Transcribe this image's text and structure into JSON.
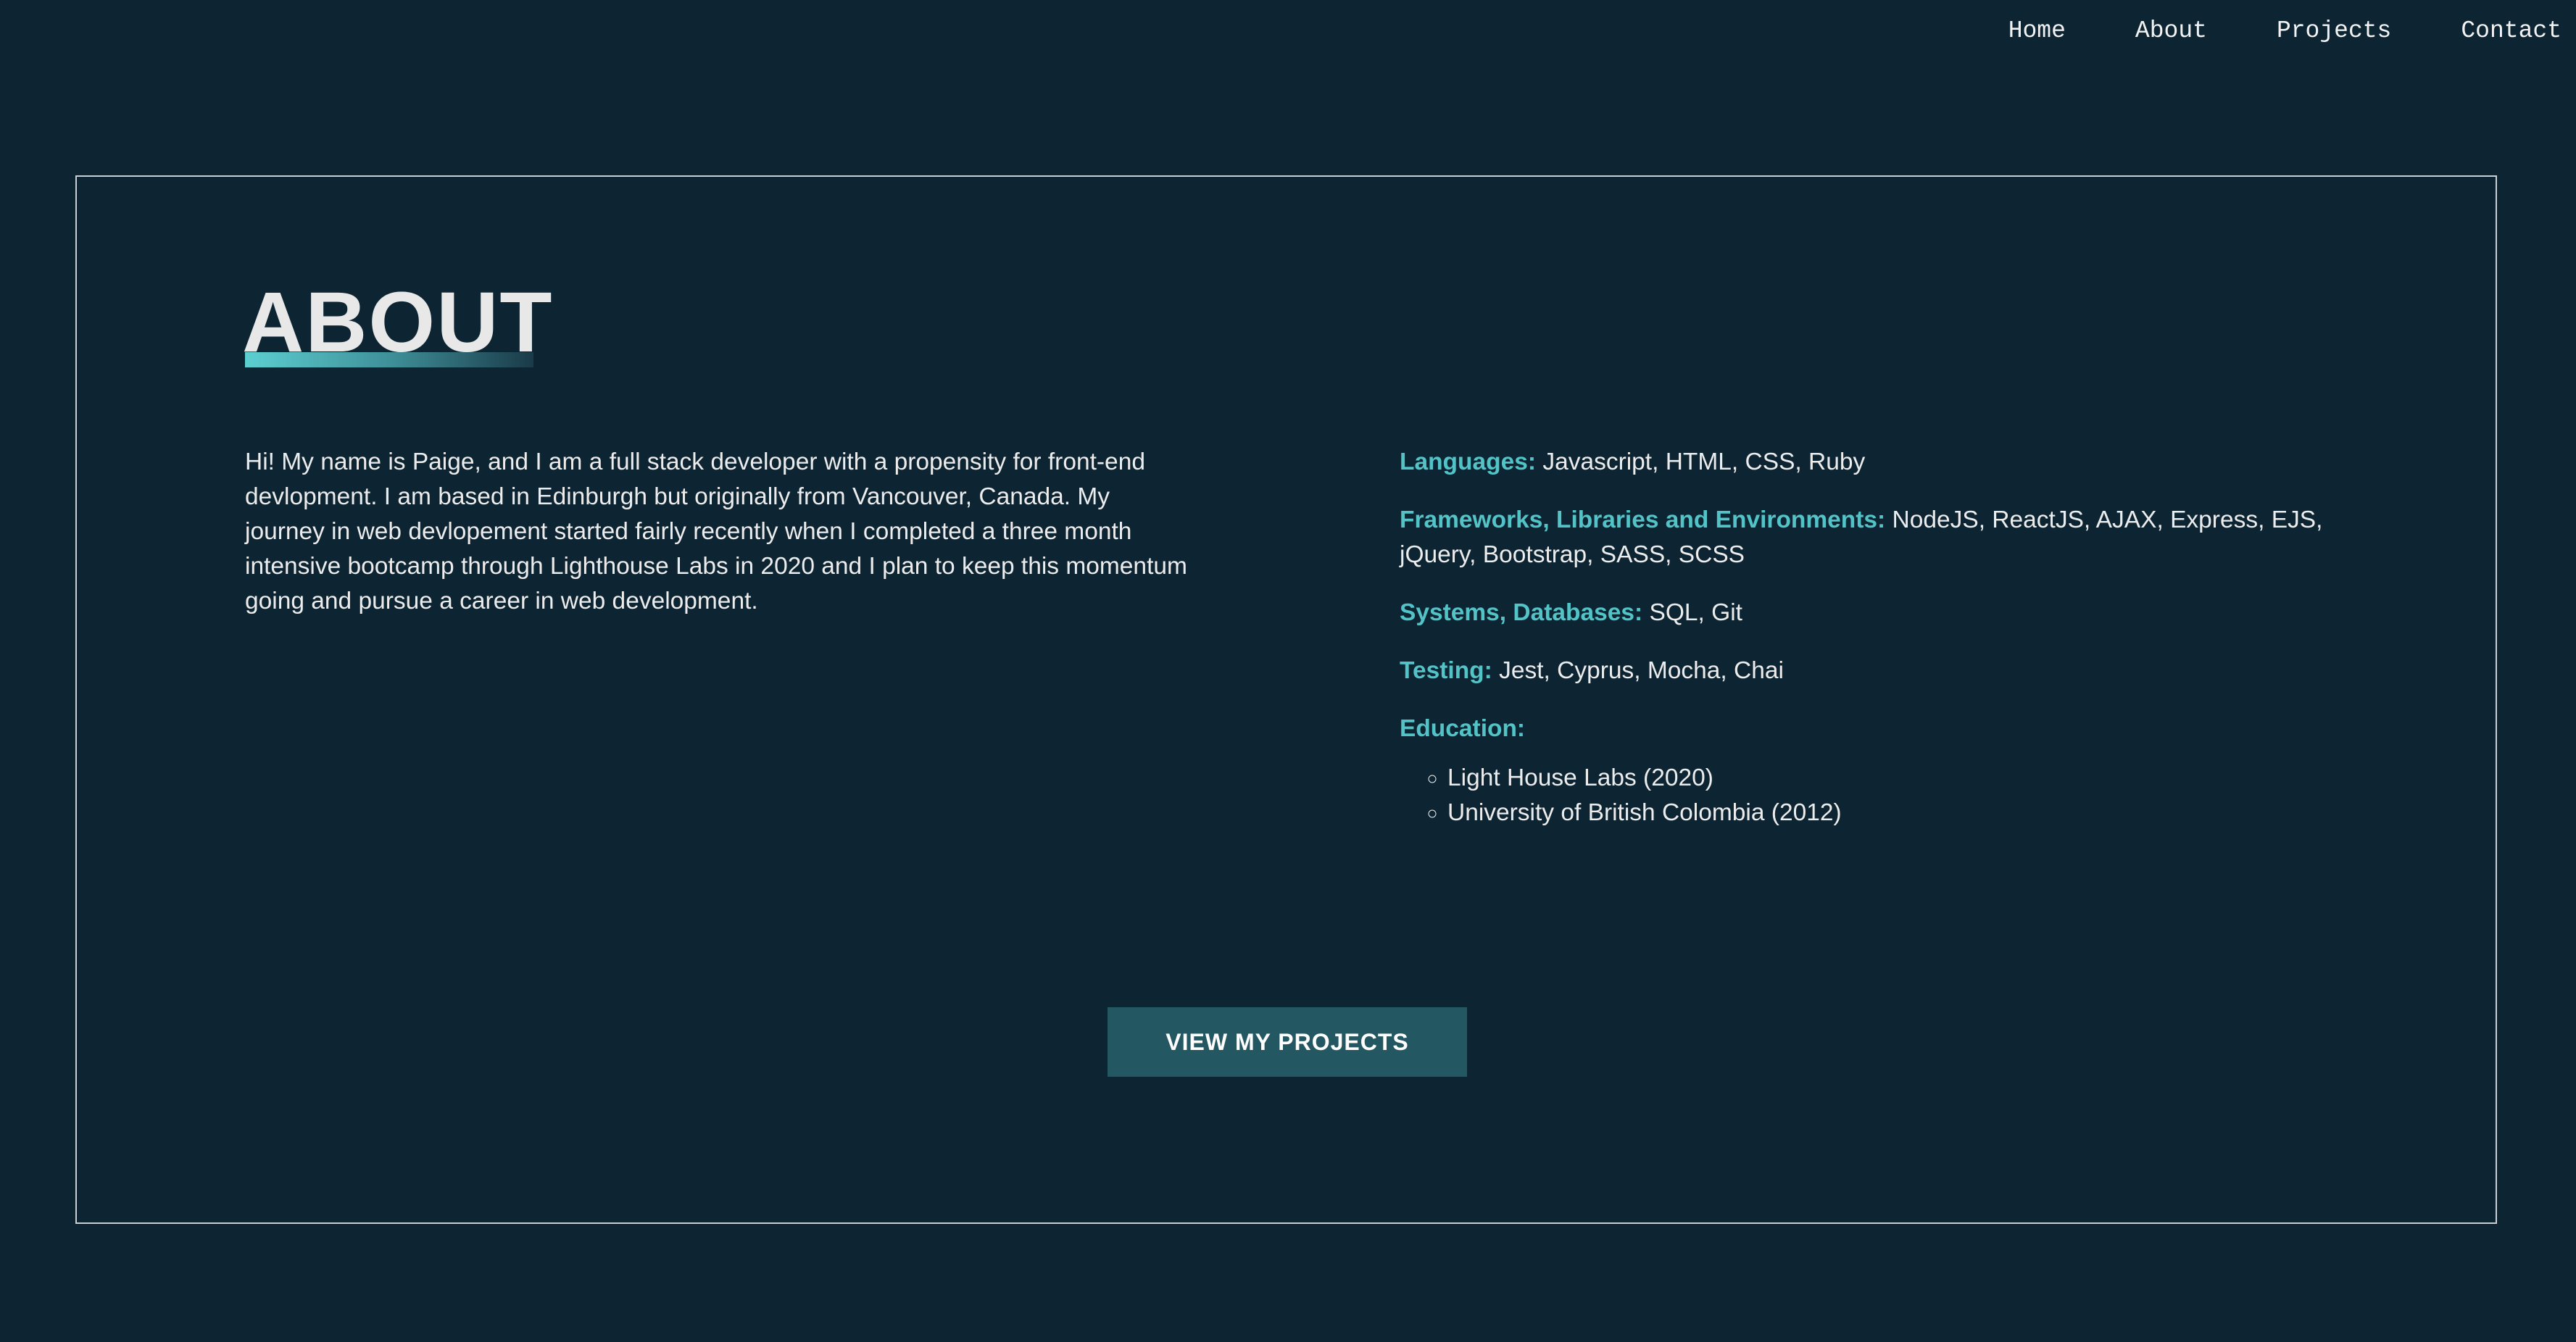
{
  "nav": {
    "items": [
      {
        "label": "Home"
      },
      {
        "label": "About"
      },
      {
        "label": "Projects"
      },
      {
        "label": "Contact"
      }
    ]
  },
  "about": {
    "title": "ABOUT",
    "bio": "Hi! My name is Paige, and I am a full stack developer with a propensity for front-end devlopment. I am based in Edinburgh but originally from Vancouver, Canada. My journey in web devlopement started fairly recently when I completed a three month intensive bootcamp through Lighthouse Labs in 2020 and I plan to keep this momentum going and pursue a career in web development.",
    "skills": [
      {
        "label": "Languages:",
        "value": "Javascript, HTML, CSS, Ruby"
      },
      {
        "label": "Frameworks, Libraries and Environments:",
        "value": "NodeJS, ReactJS, AJAX, Express, EJS, jQuery, Bootstrap, SASS, SCSS"
      },
      {
        "label": "Systems, Databases:",
        "value": "SQL, Git"
      },
      {
        "label": "Testing:",
        "value": "Jest, Cyprus, Mocha, Chai"
      }
    ],
    "education_label": "Education:",
    "education": [
      "Light House Labs (2020)",
      "University of British Colombia (2012)"
    ],
    "button_label": "VIEW MY PROJECTS"
  },
  "colors": {
    "background": "#0d2532",
    "accent": "#52c4c8",
    "button": "#235862"
  }
}
